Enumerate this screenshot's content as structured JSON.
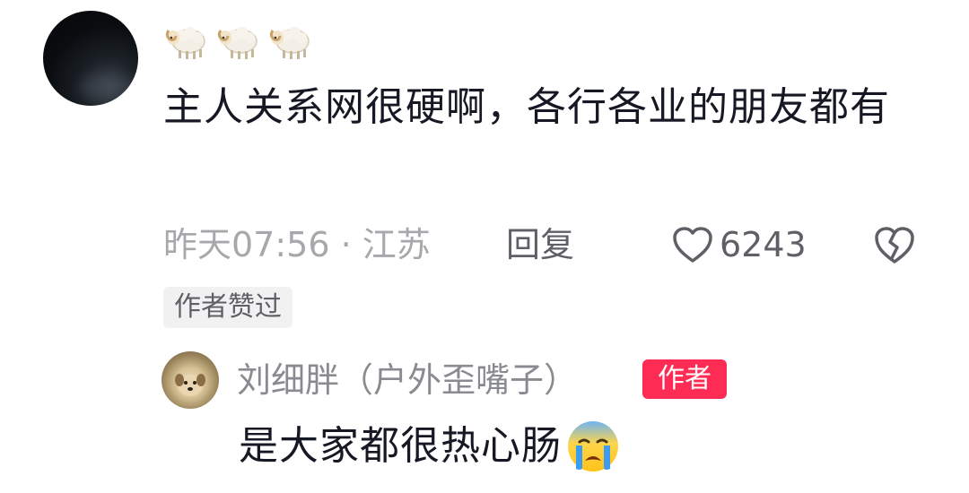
{
  "comment": {
    "nickname_icons": [
      "sheep-emoji",
      "sheep-emoji",
      "sheep-emoji"
    ],
    "text": "主人关系网很硬啊，各行各业的朋友都有",
    "time_location": "昨天07:56 · 江苏",
    "reply_label": "回复",
    "like_count": "6243",
    "author_liked_tag": "作者赞过"
  },
  "reply": {
    "username": "刘细胖（户外歪嘴子）",
    "badge": "作者",
    "text": "是大家都很热心肠",
    "emoji": "crying-face-emoji"
  },
  "colors": {
    "text_primary": "#161823",
    "text_secondary": "#a7a8ab",
    "text_action": "#5f6066",
    "author_badge": "#fe2c55",
    "tag_background": "#f1f1f2"
  }
}
